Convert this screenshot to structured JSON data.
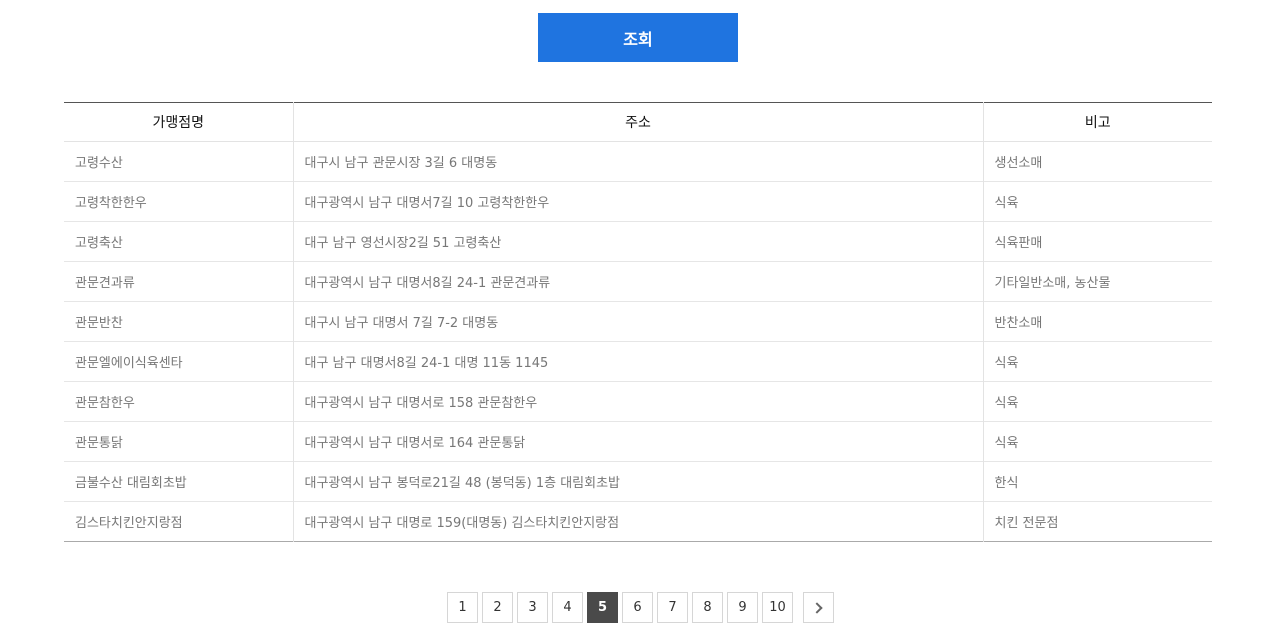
{
  "search": {
    "label": "조회"
  },
  "table": {
    "headers": [
      "가맹점명",
      "주소",
      "비고"
    ],
    "rows": [
      [
        "고령수산",
        "대구시 남구 관문시장 3길 6 대명동",
        "생선소매"
      ],
      [
        "고령착한한우",
        "대구광역시 남구 대명서7길 10 고령착한한우",
        "식육"
      ],
      [
        "고령축산",
        "대구 남구 영선시장2길 51 고령축산",
        "식육판매"
      ],
      [
        "관문견과류",
        "대구광역시 남구 대명서8길 24-1 관문견과류",
        "기타일반소매, 농산물"
      ],
      [
        "관문반찬",
        "대구시 남구 대명서 7길 7-2 대명동",
        "반찬소매"
      ],
      [
        "관문엘에이식육센타",
        "대구 남구 대명서8길 24-1 대명 11동 1145",
        "식육"
      ],
      [
        "관문참한우",
        "대구광역시 남구 대명서로 158 관문참한우",
        "식육"
      ],
      [
        "관문통닭",
        "대구광역시 남구 대명서로 164 관문통닭",
        "식육"
      ],
      [
        "금불수산 대림회초밥",
        "대구광역시 남구 봉덕로21길 48 (봉덕동) 1층 대림회초밥",
        "한식"
      ],
      [
        "김스타치킨안지랑점",
        "대구광역시 남구 대명로 159(대명동) 김스타치킨안지랑점",
        "치킨 전문점"
      ]
    ]
  },
  "pagination": {
    "pages": [
      "1",
      "2",
      "3",
      "4",
      "5",
      "6",
      "7",
      "8",
      "9",
      "10"
    ],
    "current": "5",
    "next_icon": "chevron-right-icon"
  },
  "colors": {
    "accent": "#1f74e0",
    "active_page": "#4a4a4a"
  }
}
